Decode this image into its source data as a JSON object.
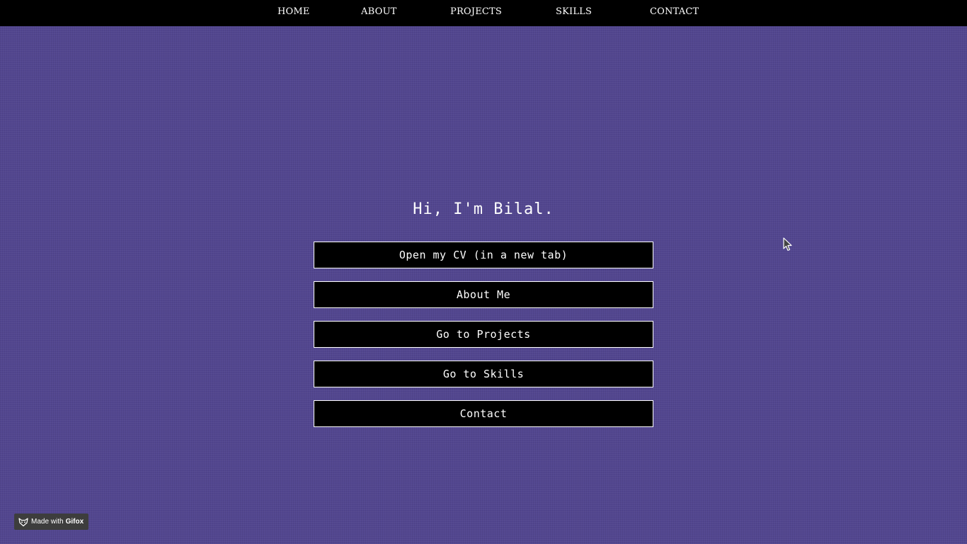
{
  "nav": {
    "items": [
      {
        "label": "HOME"
      },
      {
        "label": "ABOUT"
      },
      {
        "label": "PROJECTS"
      },
      {
        "label": "SKILLS"
      },
      {
        "label": "CONTACT"
      }
    ]
  },
  "hero": {
    "greeting": "Hi, I'm Bilal."
  },
  "actions": {
    "open_cv": "Open my CV (in a new tab)",
    "about_me": "About Me",
    "go_projects": "Go to Projects",
    "go_skills": "Go to Skills",
    "contact": "Contact"
  },
  "badge": {
    "prefix": "Made with",
    "brand": "Gifox",
    "icon": "fox-logo-icon"
  },
  "colors": {
    "background": "#52468f",
    "nav_background": "#000000",
    "button_background": "#000000",
    "button_border": "#ffffff",
    "text": "#ffffff"
  }
}
